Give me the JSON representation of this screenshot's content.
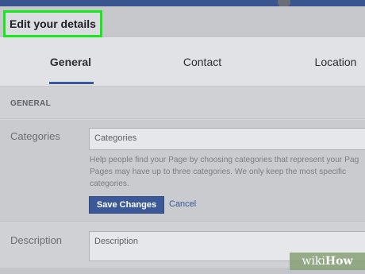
{
  "modal": {
    "title": "Edit your details"
  },
  "tabs": [
    {
      "label": "General",
      "active": true
    },
    {
      "label": "Contact",
      "active": false
    },
    {
      "label": "Location",
      "active": false
    }
  ],
  "section": {
    "heading": "GENERAL"
  },
  "categories": {
    "label": "Categories",
    "input_value": "Categories",
    "help_lines": [
      "Help people find your Page by choosing categories that represent your Pag",
      "Pages may have up to three categories. We only keep the most specific",
      "categories."
    ],
    "save_label": "Save Changes",
    "cancel_label": "Cancel"
  },
  "description": {
    "label": "Description",
    "input_value": "Description"
  },
  "watermark": {
    "wiki": "wiki",
    "how": "How"
  },
  "colors": {
    "accent": "#3b5998",
    "highlight": "#17e81e",
    "header_bar": "#39558f"
  },
  "icons": {
    "avatar": "profile-avatar-icon"
  }
}
